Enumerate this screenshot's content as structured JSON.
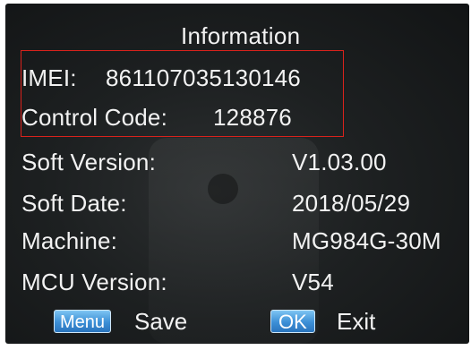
{
  "screen": {
    "title": "Information",
    "rows": [
      {
        "label": "IMEI:",
        "value": "861107035130146"
      },
      {
        "label": "Control Code:",
        "value": "128876"
      },
      {
        "label": "Soft Version:",
        "value": "V1.03.00"
      },
      {
        "label": "Soft Date:",
        "value": "2018/05/29"
      },
      {
        "label": "Machine:",
        "value": "MG984G-30M"
      },
      {
        "label": "MCU Version:",
        "value": "V54"
      }
    ],
    "highlight_color": "#d9221c"
  },
  "footer": {
    "menu_key": "Menu",
    "menu_action": "Save",
    "ok_key": "OK",
    "ok_action": "Exit",
    "key_color": "#3c8fd6"
  }
}
